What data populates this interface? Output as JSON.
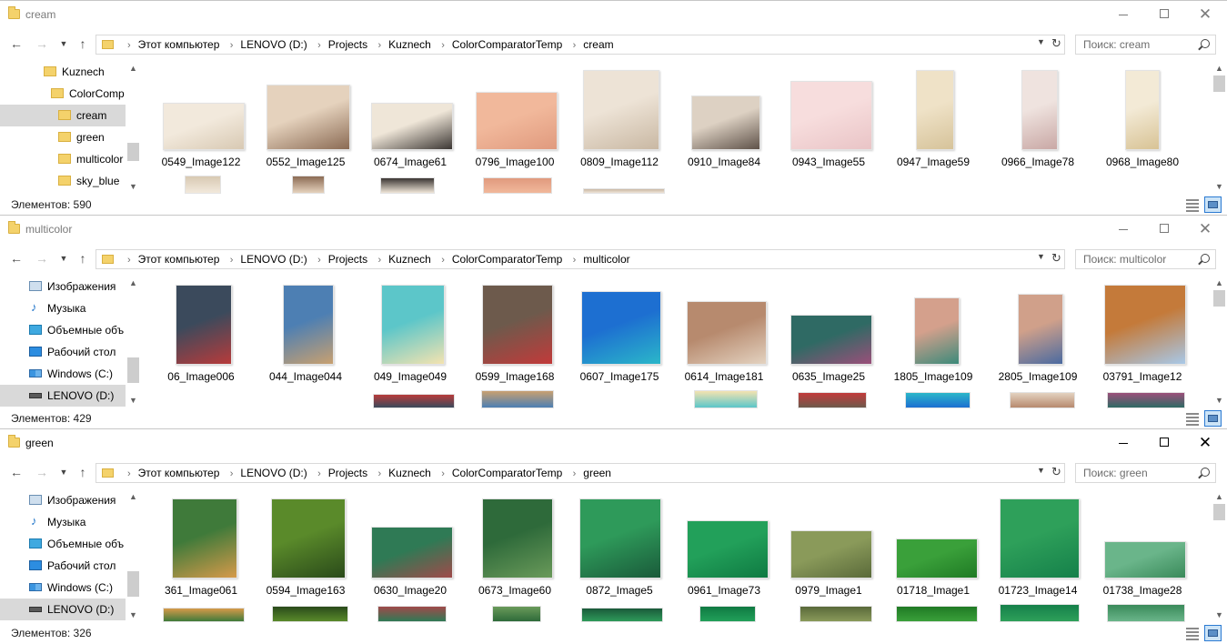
{
  "windows": [
    {
      "title": "cream",
      "active": false,
      "breadcrumb": [
        "Этот компьютер",
        "LENOVO (D:)",
        "Projects",
        "Kuznech",
        "ColorComparatorTemp",
        "cream"
      ],
      "search_placeholder": "Поиск: cream",
      "status": "Элементов: 590",
      "tree": [
        {
          "label": "Kuznech",
          "icon": "folder-icon",
          "selected": false
        },
        {
          "label": "ColorComp",
          "icon": "folder-icon",
          "selected": false
        },
        {
          "label": "cream",
          "icon": "folder-icon",
          "selected": true
        },
        {
          "label": "green",
          "icon": "folder-icon",
          "selected": false
        },
        {
          "label": "multicolor",
          "icon": "folder-icon",
          "selected": false
        },
        {
          "label": "sky_blue",
          "icon": "folder-icon",
          "selected": false
        }
      ],
      "files": [
        {
          "name": "0549_Image122",
          "c1": "#f2e9dc",
          "c2": "#d8c9b3"
        },
        {
          "name": "0552_Image125",
          "c1": "#e5d2bd",
          "c2": "#8b6b54"
        },
        {
          "name": "0674_Image61",
          "c1": "#efe6d8",
          "c2": "#3b3633"
        },
        {
          "name": "0796_Image100",
          "c1": "#f1b89b",
          "c2": "#e09a7e"
        },
        {
          "name": "0809_Image112",
          "c1": "#ede3d6",
          "c2": "#c9b8a3"
        },
        {
          "name": "0910_Image84",
          "c1": "#ddd1c3",
          "c2": "#5f5249"
        },
        {
          "name": "0943_Image55",
          "c1": "#f7dddd",
          "c2": "#e9c4c6"
        },
        {
          "name": "0947_Image59",
          "c1": "#efe2c7",
          "c2": "#d6c39a"
        },
        {
          "name": "0966_Image78",
          "c1": "#efe3df",
          "c2": "#c9a8a5"
        },
        {
          "name": "0968_Image80",
          "c1": "#f3ead6",
          "c2": "#d8c395"
        }
      ]
    },
    {
      "title": "multicolor",
      "active": false,
      "breadcrumb": [
        "Этот компьютер",
        "LENOVO (D:)",
        "Projects",
        "Kuznech",
        "ColorComparatorTemp",
        "multicolor"
      ],
      "search_placeholder": "Поиск: multicolor",
      "status": "Элементов: 429",
      "tree": [
        {
          "label": "Изображения",
          "icon": "pictures-icon",
          "selected": false
        },
        {
          "label": "Музыка",
          "icon": "music-icon",
          "selected": false
        },
        {
          "label": "Объемные объ",
          "icon": "3d-objects-icon",
          "selected": false
        },
        {
          "label": "Рабочий стол",
          "icon": "desktop-icon",
          "selected": false
        },
        {
          "label": "Windows (C:)",
          "icon": "windows-drive-icon",
          "selected": false
        },
        {
          "label": "LENOVO (D:)",
          "icon": "drive-icon",
          "selected": true
        }
      ],
      "files": [
        {
          "name": "06_Image006",
          "c1": "#3b4a5c",
          "c2": "#b83b3b"
        },
        {
          "name": "044_Image044",
          "c1": "#4d7fb3",
          "c2": "#c8a070"
        },
        {
          "name": "049_Image049",
          "c1": "#5cc6c9",
          "c2": "#f4e3b0"
        },
        {
          "name": "0599_Image168",
          "c1": "#6d5a4c",
          "c2": "#c23a3a"
        },
        {
          "name": "0607_Image175",
          "c1": "#1d6fd1",
          "c2": "#2bb7c9"
        },
        {
          "name": "0614_Image181",
          "c1": "#b78a6e",
          "c2": "#e3d2c0"
        },
        {
          "name": "0635_Image25",
          "c1": "#2f6a64",
          "c2": "#9b4f7a"
        },
        {
          "name": "1805_Image109",
          "c1": "#d4a08c",
          "c2": "#3c8a7a"
        },
        {
          "name": "2805_Image109",
          "c1": "#d0a08a",
          "c2": "#4a6aa0"
        },
        {
          "name": "03791_Image12",
          "c1": "#c47a3a",
          "c2": "#a8c8e8"
        }
      ]
    },
    {
      "title": "green",
      "active": true,
      "breadcrumb": [
        "Этот компьютер",
        "LENOVO (D:)",
        "Projects",
        "Kuznech",
        "ColorComparatorTemp",
        "green"
      ],
      "search_placeholder": "Поиск: green",
      "status": "Элементов: 326",
      "tree": [
        {
          "label": "Изображения",
          "icon": "pictures-icon",
          "selected": false
        },
        {
          "label": "Музыка",
          "icon": "music-icon",
          "selected": false
        },
        {
          "label": "Объемные объ",
          "icon": "3d-objects-icon",
          "selected": false
        },
        {
          "label": "Рабочий стол",
          "icon": "desktop-icon",
          "selected": false
        },
        {
          "label": "Windows (C:)",
          "icon": "windows-drive-icon",
          "selected": false
        },
        {
          "label": "LENOVO (D:)",
          "icon": "drive-icon",
          "selected": true
        }
      ],
      "files": [
        {
          "name": "361_Image061",
          "c1": "#3f7a3a",
          "c2": "#d69a4a"
        },
        {
          "name": "0594_Image163",
          "c1": "#5a8a2a",
          "c2": "#2a4a1a"
        },
        {
          "name": "0630_Image20",
          "c1": "#2f7a55",
          "c2": "#a04a4a"
        },
        {
          "name": "0673_Image60",
          "c1": "#2e6a3a",
          "c2": "#6a9a5a"
        },
        {
          "name": "0872_Image5",
          "c1": "#2e9a5a",
          "c2": "#1a5a3a"
        },
        {
          "name": "0961_Image73",
          "c1": "#22a05a",
          "c2": "#0f7a42"
        },
        {
          "name": "0979_Image1",
          "c1": "#8a9a5a",
          "c2": "#5a6a3a"
        },
        {
          "name": "01718_Image1",
          "c1": "#3aa03a",
          "c2": "#1f7a24"
        },
        {
          "name": "01723_Image14",
          "c1": "#2ea05a",
          "c2": "#15804a"
        },
        {
          "name": "01738_Image28",
          "c1": "#6ab58a",
          "c2": "#3a8a5a"
        }
      ]
    }
  ],
  "colors": {
    "folder": "#f4d26b",
    "selected": "#d9d9d9",
    "accent": "#2c7bd2"
  }
}
